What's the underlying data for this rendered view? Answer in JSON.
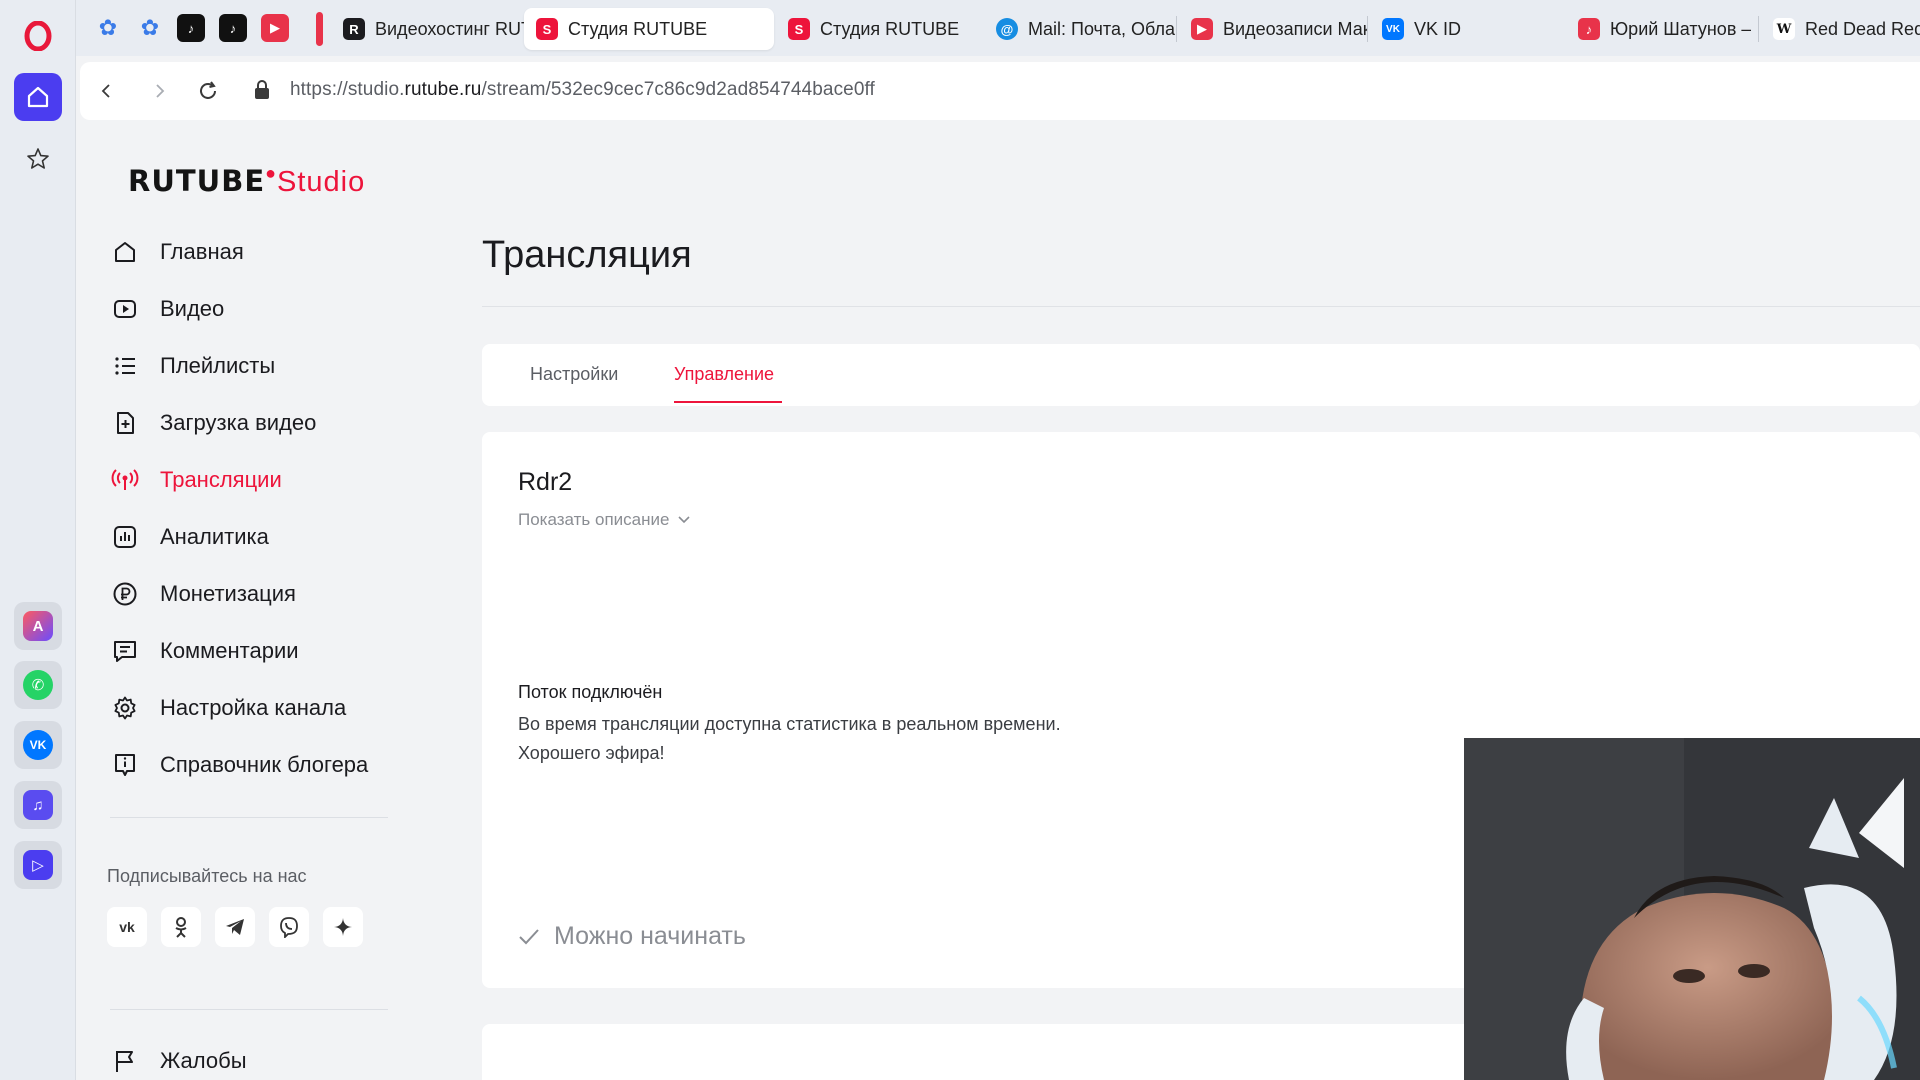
{
  "browser": {
    "tabs": [
      {
        "title": "Видеохостинг RUT",
        "favicon": "rutube-r-icon",
        "color": "#1b1b1f"
      },
      {
        "title": "Студия RUTUBE",
        "favicon": "rutube-studio-icon",
        "color": "#ed143b",
        "active": true
      },
      {
        "title": "Студия RUTUBE",
        "favicon": "rutube-studio-icon",
        "color": "#ed143b"
      },
      {
        "title": "Mail: Почта, Обла",
        "favicon": "mail-at-icon",
        "color": "#168de2"
      },
      {
        "title": "Видеозаписи Мак",
        "favicon": "video-play-icon",
        "color": "#e8334a"
      },
      {
        "title": "VK ID",
        "favicon": "vk-icon",
        "color": "#0077ff"
      },
      {
        "title": "Юрий Шатунов –",
        "favicon": "music-icon",
        "color": "#e8334a"
      },
      {
        "title": "Red Dead Rede",
        "favicon": "wikipedia-icon",
        "color": "#ffffff"
      }
    ],
    "url_prefix": "https://studio.",
    "url_domain": "rutube.ru",
    "url_path": "/stream/532ec9cec7c86c9d2ad854744bace0ff"
  },
  "sidebar": {
    "logo_main": "RUTUBE",
    "logo_sub": "Studio",
    "items": [
      {
        "label": "Главная",
        "icon": "home-icon"
      },
      {
        "label": "Видео",
        "icon": "video-icon"
      },
      {
        "label": "Плейлисты",
        "icon": "playlist-icon"
      },
      {
        "label": "Загрузка видео",
        "icon": "upload-icon"
      },
      {
        "label": "Трансляции",
        "icon": "broadcast-icon",
        "active": true
      },
      {
        "label": "Аналитика",
        "icon": "analytics-icon"
      },
      {
        "label": "Монетизация",
        "icon": "ruble-icon"
      },
      {
        "label": "Комментарии",
        "icon": "comments-icon"
      },
      {
        "label": "Настройка канала",
        "icon": "gear-icon"
      },
      {
        "label": "Справочник блогера",
        "icon": "info-icon"
      }
    ],
    "follow_label": "Подписывайтесь на нас",
    "socials": [
      "vk-icon",
      "odnoklassniki-icon",
      "telegram-icon",
      "viber-icon",
      "dzen-icon"
    ],
    "complaints_label": "Жалобы"
  },
  "main": {
    "title": "Трансляция",
    "tabs": [
      {
        "label": "Настройки"
      },
      {
        "label": "Управление",
        "active": true
      }
    ],
    "stream": {
      "name": "Rdr2",
      "show_description": "Показать описание",
      "status_title": "Поток подключён",
      "status_line1": "Во время трансляции доступна статистика в реальном времени.",
      "status_line2": "Хорошего эфира!",
      "ready_label": "Можно начинать"
    }
  },
  "colors": {
    "accent": "#ed143b",
    "opera_accent": "#4b3df0"
  }
}
